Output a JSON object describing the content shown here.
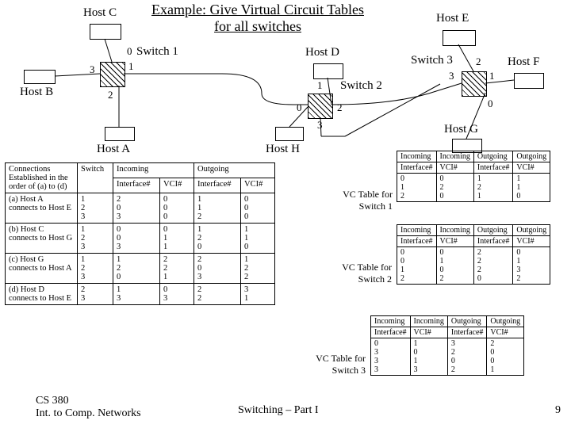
{
  "title_line": "Example: Give Virtual Circuit Tables for all switches",
  "hosts": {
    "A": "Host A",
    "B": "Host B",
    "C": "Host C",
    "D": "Host D",
    "E": "Host E",
    "F": "Host F",
    "G": "Host G",
    "H": "Host H"
  },
  "switches": {
    "S1": "Switch 1",
    "S2": "Switch 2",
    "S3": "Switch 3"
  },
  "ports": {
    "p0": "0",
    "p1": "1",
    "p2": "2",
    "p3": "3"
  },
  "conn_table": {
    "headers": {
      "conn_a": "Connections",
      "conn_b": "Established in the order of (a) to (d)",
      "switch": "Switch",
      "in": "Incoming",
      "in_if": "Interface#",
      "in_vci": "VCI#",
      "out": "Outgoing",
      "out_if": "Interface#",
      "out_vci": "VCI#"
    },
    "rows": [
      {
        "label": "(a) Host A connects to Host E",
        "sw": [
          "1",
          "2",
          "3"
        ],
        "in_if": [
          "2",
          "0",
          "3"
        ],
        "in_vci": [
          "0",
          "0",
          "0"
        ],
        "out_if": [
          "1",
          "1",
          "2"
        ],
        "out_vci": [
          "0",
          "0",
          "0"
        ]
      },
      {
        "label": "(b) Host C connects to Host G",
        "sw": [
          "1",
          "2",
          "3"
        ],
        "in_if": [
          "0",
          "0",
          "3"
        ],
        "in_vci": [
          "0",
          "1",
          "1"
        ],
        "out_if": [
          "1",
          "2",
          "0"
        ],
        "out_vci": [
          "1",
          "1",
          "0"
        ]
      },
      {
        "label": "(c) Host G connects to Host A",
        "sw": [
          "1",
          "2",
          "3"
        ],
        "in_if": [
          "1",
          "2",
          "0"
        ],
        "in_vci": [
          "2",
          "2",
          "1"
        ],
        "out_if": [
          "2",
          "0",
          "3"
        ],
        "out_vci": [
          "1",
          "2",
          "2"
        ]
      },
      {
        "label": "(d) Host D connects to Host E",
        "sw": [
          "2",
          "3"
        ],
        "in_if": [
          "1",
          "3"
        ],
        "in_vci": [
          "0",
          "3"
        ],
        "out_if": [
          "2",
          "2"
        ],
        "out_vci": [
          "3",
          "1"
        ]
      }
    ]
  },
  "vc_tables": {
    "headers": {
      "in": "Incoming",
      "in_if": "Interface#",
      "in_vci": "VCI#",
      "out": "Outgoing",
      "out_if": "Interface#",
      "out_vci": "VCI#"
    },
    "s1": {
      "label": "VC Table for Switch 1",
      "in_if": [
        "0",
        "1",
        "2"
      ],
      "in_vci": [
        "0",
        "2",
        "0"
      ],
      "out_if": [
        "1",
        "2",
        "1"
      ],
      "out_vci": [
        "1",
        "1",
        "0"
      ]
    },
    "s2": {
      "label": "VC Table for Switch 2",
      "in_if": [
        "0",
        "0",
        "1",
        "2"
      ],
      "in_vci": [
        "0",
        "1",
        "0",
        "2"
      ],
      "out_if": [
        "2",
        "2",
        "2",
        "0"
      ],
      "out_vci": [
        "0",
        "1",
        "3",
        "2"
      ]
    },
    "s3": {
      "label": "VC Table for Switch 3",
      "in_if": [
        "0",
        "3",
        "3",
        "3"
      ],
      "in_vci": [
        "1",
        "0",
        "1",
        "3"
      ],
      "out_if": [
        "3",
        "2",
        "0",
        "2"
      ],
      "out_vci": [
        "2",
        "0",
        "0",
        "1"
      ]
    }
  },
  "footer": {
    "left_a": "CS 380",
    "left_b": "Int. to Comp. Networks",
    "center": "Switching – Part I",
    "right": "9"
  }
}
